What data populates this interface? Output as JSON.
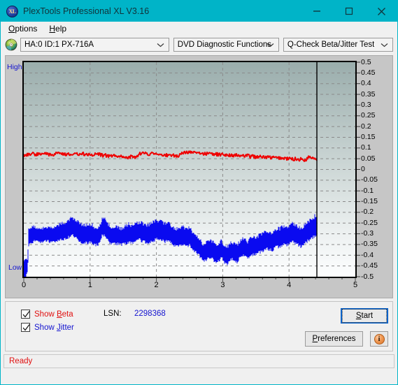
{
  "window": {
    "title": "PlexTools Professional XL V3.16",
    "icon": "XL",
    "icon_name": "app-icon-xl",
    "controls": {
      "minimize": "minimize-icon",
      "maximize": "maximize-icon",
      "close": "close-icon"
    },
    "titlebar_color": "#00b4c8"
  },
  "menu": {
    "items": [
      {
        "label": "Options",
        "accel": "O"
      },
      {
        "label": "Help",
        "accel": "H"
      }
    ]
  },
  "toolbar": {
    "disc_icon": "disc-icon",
    "drive_select": {
      "value": "HA:0 ID:1  PX-716A",
      "options": [
        "HA:0 ID:1  PX-716A"
      ]
    },
    "function_select": {
      "value": "DVD Diagnostic Functions",
      "options": [
        "DVD Diagnostic Functions"
      ]
    },
    "test_select": {
      "value": "Q-Check Beta/Jitter Test",
      "options": [
        "Q-Check Beta/Jitter Test"
      ]
    }
  },
  "options": {
    "show_beta": {
      "label": "Show Beta",
      "accel": "B",
      "checked": true,
      "color": "#e01010"
    },
    "show_jitter": {
      "label": "Show Jitter",
      "accel": "J",
      "checked": true,
      "color": "#1414cf"
    },
    "lsn_label": "LSN:",
    "lsn_value": "2298368",
    "start_button": {
      "label": "Start",
      "accel": "S"
    },
    "preferences_button": {
      "label": "Preferences",
      "accel": "P"
    },
    "info_button": {
      "icon": "info-icon",
      "glyph": "i"
    }
  },
  "status": {
    "text": "Ready",
    "color": "#e01010"
  },
  "chart_data": {
    "type": "line",
    "title": "",
    "xlabel": "",
    "ylabel": "",
    "xlim": [
      0,
      5
    ],
    "ylim": [
      -0.5,
      0.5
    ],
    "grid": true,
    "legend": "none",
    "axis_left_labels": {
      "top": "High",
      "bottom": "Low",
      "color": "#1414cf"
    },
    "x_ticks": [
      0,
      1,
      2,
      3,
      4,
      5
    ],
    "x_minor_per_major": 5,
    "y_ticks": [
      0.5,
      0.45,
      0.4,
      0.35,
      0.3,
      0.25,
      0.2,
      0.15,
      0.1,
      0.05,
      0,
      -0.05,
      -0.1,
      -0.15,
      -0.2,
      -0.25,
      -0.3,
      -0.35,
      -0.4,
      -0.45,
      -0.5
    ],
    "y_gridlines": [
      0.45,
      0.4,
      0.35,
      0.3,
      0.25,
      0.2,
      0.15,
      0.1,
      0.05,
      0,
      -0.05,
      -0.1,
      -0.15,
      -0.2,
      -0.25,
      -0.3,
      -0.35,
      -0.4,
      -0.45
    ],
    "cursor_line_x": 4.42,
    "data_end_x": 4.42,
    "series": [
      {
        "name": "Beta",
        "color": "#ee0000",
        "x": [
          0.02,
          0.06,
          0.1,
          0.14,
          0.18,
          0.22,
          0.26,
          0.3,
          0.34,
          0.38,
          0.42,
          0.46,
          0.5,
          0.54,
          0.58,
          0.62,
          0.66,
          0.7,
          0.74,
          0.78,
          0.82,
          0.86,
          0.9,
          0.94,
          0.98,
          1.02,
          1.06,
          1.1,
          1.14,
          1.18,
          1.22,
          1.26,
          1.3,
          1.34,
          1.38,
          1.42,
          1.46,
          1.5,
          1.54,
          1.58,
          1.62,
          1.66,
          1.7,
          1.74,
          1.78,
          1.82,
          1.86,
          1.9,
          1.94,
          1.98,
          2.02,
          2.06,
          2.1,
          2.14,
          2.18,
          2.22,
          2.26,
          2.3,
          2.34,
          2.38,
          2.42,
          2.46,
          2.5,
          2.54,
          2.58,
          2.62,
          2.66,
          2.7,
          2.74,
          2.78,
          2.82,
          2.86,
          2.9,
          2.94,
          2.98,
          3.02,
          3.06,
          3.1,
          3.14,
          3.18,
          3.22,
          3.26,
          3.3,
          3.34,
          3.38,
          3.42,
          3.46,
          3.5,
          3.54,
          3.58,
          3.62,
          3.66,
          3.7,
          3.74,
          3.78,
          3.82,
          3.86,
          3.9,
          3.94,
          3.98,
          4.02,
          4.06,
          4.1,
          4.14,
          4.18,
          4.22,
          4.26,
          4.3,
          4.34,
          4.38,
          4.4,
          4.42
        ],
        "y": [
          0.068,
          0.072,
          0.067,
          0.074,
          0.069,
          0.073,
          0.067,
          0.071,
          0.075,
          0.069,
          0.073,
          0.07,
          0.075,
          0.071,
          0.076,
          0.07,
          0.074,
          0.072,
          0.076,
          0.071,
          0.074,
          0.07,
          0.073,
          0.069,
          0.072,
          0.068,
          0.071,
          0.067,
          0.07,
          0.065,
          0.068,
          0.063,
          0.066,
          0.061,
          0.064,
          0.06,
          0.062,
          0.058,
          0.061,
          0.057,
          0.06,
          0.056,
          0.059,
          0.073,
          0.076,
          0.072,
          0.075,
          0.071,
          0.074,
          0.07,
          0.072,
          0.068,
          0.07,
          0.066,
          0.068,
          0.064,
          0.067,
          0.063,
          0.066,
          0.078,
          0.081,
          0.077,
          0.08,
          0.076,
          0.078,
          0.074,
          0.077,
          0.073,
          0.075,
          0.071,
          0.074,
          0.07,
          0.072,
          0.068,
          0.071,
          0.067,
          0.07,
          0.066,
          0.068,
          0.064,
          0.067,
          0.062,
          0.065,
          0.061,
          0.064,
          0.06,
          0.062,
          0.058,
          0.061,
          0.057,
          0.059,
          0.055,
          0.058,
          0.054,
          0.056,
          0.052,
          0.055,
          0.051,
          0.053,
          0.049,
          0.051,
          0.047,
          0.05,
          0.046,
          0.048,
          0.044,
          0.046,
          0.06,
          0.057,
          0.053,
          0.05,
          0.047
        ]
      },
      {
        "name": "Jitter",
        "color": "#0a0af0",
        "description": "dense noisy band; value pairs are per-x band min/max",
        "x": [
          0.0,
          0.03,
          0.06,
          0.07,
          0.1,
          0.14,
          0.18,
          0.22,
          0.26,
          0.3,
          0.34,
          0.38,
          0.42,
          0.46,
          0.5,
          0.54,
          0.58,
          0.62,
          0.66,
          0.7,
          0.74,
          0.78,
          0.82,
          0.86,
          0.9,
          0.94,
          0.98,
          1.02,
          1.06,
          1.1,
          1.14,
          1.18,
          1.22,
          1.26,
          1.3,
          1.34,
          1.38,
          1.42,
          1.46,
          1.5,
          1.54,
          1.58,
          1.62,
          1.66,
          1.7,
          1.74,
          1.78,
          1.82,
          1.86,
          1.9,
          1.94,
          1.98,
          2.02,
          2.06,
          2.1,
          2.14,
          2.18,
          2.22,
          2.26,
          2.3,
          2.34,
          2.38,
          2.42,
          2.46,
          2.5,
          2.54,
          2.58,
          2.62,
          2.66,
          2.7,
          2.74,
          2.78,
          2.82,
          2.86,
          2.9,
          2.94,
          2.98,
          3.02,
          3.06,
          3.1,
          3.14,
          3.18,
          3.22,
          3.26,
          3.3,
          3.34,
          3.38,
          3.42,
          3.46,
          3.5,
          3.54,
          3.58,
          3.62,
          3.66,
          3.7,
          3.74,
          3.78,
          3.82,
          3.86,
          3.9,
          3.94,
          3.98,
          4.02,
          4.06,
          4.1,
          4.14,
          4.18,
          4.22,
          4.26,
          4.3,
          4.34,
          4.38,
          4.42
        ],
        "y_min": [
          -0.5,
          -0.495,
          -0.47,
          -0.345,
          -0.34,
          -0.33,
          -0.325,
          -0.33,
          -0.335,
          -0.33,
          -0.325,
          -0.33,
          -0.335,
          -0.33,
          -0.325,
          -0.32,
          -0.325,
          -0.315,
          -0.31,
          -0.305,
          -0.3,
          -0.31,
          -0.32,
          -0.33,
          -0.335,
          -0.33,
          -0.335,
          -0.33,
          -0.34,
          -0.345,
          -0.34,
          -0.3,
          -0.295,
          -0.32,
          -0.335,
          -0.34,
          -0.335,
          -0.34,
          -0.345,
          -0.34,
          -0.335,
          -0.33,
          -0.335,
          -0.33,
          -0.325,
          -0.32,
          -0.325,
          -0.33,
          -0.335,
          -0.33,
          -0.325,
          -0.32,
          -0.315,
          -0.32,
          -0.325,
          -0.33,
          -0.325,
          -0.335,
          -0.345,
          -0.35,
          -0.345,
          -0.34,
          -0.345,
          -0.35,
          -0.345,
          -0.36,
          -0.375,
          -0.385,
          -0.4,
          -0.42,
          -0.415,
          -0.405,
          -0.4,
          -0.415,
          -0.425,
          -0.42,
          -0.4,
          -0.425,
          -0.435,
          -0.42,
          -0.41,
          -0.42,
          -0.425,
          -0.405,
          -0.39,
          -0.4,
          -0.41,
          -0.395,
          -0.385,
          -0.39,
          -0.38,
          -0.375,
          -0.37,
          -0.36,
          -0.365,
          -0.37,
          -0.36,
          -0.35,
          -0.355,
          -0.345,
          -0.34,
          -0.345,
          -0.335,
          -0.33,
          -0.335,
          -0.345,
          -0.355,
          -0.345,
          -0.33,
          -0.32,
          -0.31,
          -0.305,
          -0.3
        ],
        "y_max": [
          -0.44,
          -0.43,
          -0.42,
          -0.285,
          -0.28,
          -0.275,
          -0.278,
          -0.282,
          -0.285,
          -0.28,
          -0.275,
          -0.28,
          -0.283,
          -0.278,
          -0.272,
          -0.265,
          -0.262,
          -0.255,
          -0.248,
          -0.24,
          -0.235,
          -0.245,
          -0.255,
          -0.265,
          -0.272,
          -0.268,
          -0.272,
          -0.265,
          -0.278,
          -0.285,
          -0.28,
          -0.24,
          -0.235,
          -0.258,
          -0.275,
          -0.28,
          -0.275,
          -0.28,
          -0.285,
          -0.28,
          -0.272,
          -0.265,
          -0.272,
          -0.268,
          -0.262,
          -0.255,
          -0.26,
          -0.268,
          -0.272,
          -0.265,
          -0.258,
          -0.252,
          -0.248,
          -0.252,
          -0.258,
          -0.265,
          -0.258,
          -0.27,
          -0.28,
          -0.288,
          -0.282,
          -0.275,
          -0.282,
          -0.288,
          -0.282,
          -0.298,
          -0.312,
          -0.322,
          -0.338,
          -0.358,
          -0.352,
          -0.342,
          -0.338,
          -0.352,
          -0.362,
          -0.358,
          -0.338,
          -0.362,
          -0.372,
          -0.358,
          -0.348,
          -0.358,
          -0.362,
          -0.342,
          -0.328,
          -0.338,
          -0.348,
          -0.332,
          -0.322,
          -0.328,
          -0.318,
          -0.312,
          -0.305,
          -0.295,
          -0.3,
          -0.305,
          -0.295,
          -0.285,
          -0.288,
          -0.278,
          -0.272,
          -0.278,
          -0.268,
          -0.262,
          -0.268,
          -0.278,
          -0.288,
          -0.278,
          -0.262,
          -0.25,
          -0.238,
          -0.232,
          -0.226
        ]
      }
    ]
  }
}
